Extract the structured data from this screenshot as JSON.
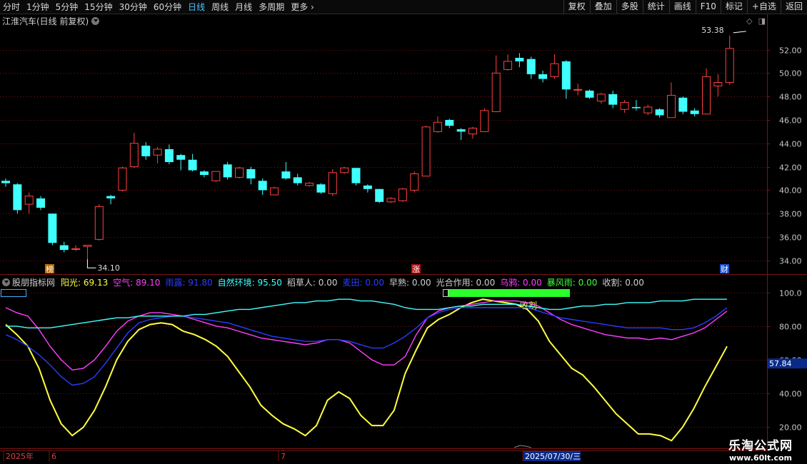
{
  "toolbar": {
    "periods": [
      "分时",
      "1分钟",
      "5分钟",
      "15分钟",
      "30分钟",
      "60分钟",
      "日线",
      "周线",
      "月线",
      "多周期",
      "更多"
    ],
    "active_period": "日线",
    "tools": [
      "复权",
      "叠加",
      "多股",
      "统计",
      "画线",
      "F10",
      "标记",
      "+自选",
      "返回"
    ]
  },
  "stock": {
    "title": "江淮汽车(日线 前复权)"
  },
  "badges": {
    "bang": "榜",
    "zhang": "涨",
    "cai": "财"
  },
  "price_annotations": {
    "high": "53.38",
    "low": "34.10"
  },
  "indicator": {
    "name": "股朋指标网",
    "legend": [
      {
        "label": "阳光: 69.13",
        "color": "#ffff40"
      },
      {
        "label": "空气: 89.10",
        "color": "#ff40ff"
      },
      {
        "label": "雨露: 91.80",
        "color": "#2a3cff"
      },
      {
        "label": "自然环境: 95.50",
        "color": "#40ffff"
      },
      {
        "label": "稻草人: 0.00",
        "color": "#d0d0d0"
      },
      {
        "label": "麦田: 0.00",
        "color": "#2a3cff"
      },
      {
        "label": "早熟: 0.00",
        "color": "#d0d0d0"
      },
      {
        "label": "光合作用: 0.00",
        "color": "#d0d0d0"
      },
      {
        "label": "乌鸦: 0.00",
        "color": "#ff40ff"
      },
      {
        "label": "暴风雨: 0.00",
        "color": "#40ff40"
      },
      {
        "label": "收割: 0.00",
        "color": "#d0d0d0"
      }
    ],
    "harvest_label": "收割",
    "current_value": "57.84"
  },
  "axis": {
    "price_ticks": [
      "52.00",
      "50.00",
      "48.00",
      "46.00",
      "44.00",
      "42.00",
      "40.00",
      "38.00",
      "36.00",
      "34.00"
    ],
    "ind_ticks": [
      "100.0",
      "80.00",
      "60.00",
      "40.00",
      "20.00"
    ],
    "date_labels": [
      "2025年",
      "6",
      "7",
      "2025/07/30/三"
    ]
  },
  "watermark": {
    "line1": "乐淘公式网",
    "line2": "www.60lt.com"
  },
  "colors": {
    "up": "#ff4040",
    "down": "#40ffff",
    "grid": "#7a1414",
    "axis": "#7a1414"
  },
  "chart_data": [
    {
      "type": "candlestick",
      "title": "江淮汽车(日线 前复权)",
      "ylim": [
        33.2,
        53.8
      ],
      "candles": [
        {
          "o": 40.8,
          "c": 40.6,
          "h": 41.0,
          "l": 40.3
        },
        {
          "o": 40.5,
          "c": 38.3,
          "h": 40.6,
          "l": 38.0
        },
        {
          "o": 38.8,
          "c": 39.5,
          "h": 39.8,
          "l": 38.0
        },
        {
          "o": 39.3,
          "c": 38.5,
          "h": 39.5,
          "l": 38.3
        },
        {
          "o": 38.0,
          "c": 35.5,
          "h": 38.0,
          "l": 35.3
        },
        {
          "o": 35.3,
          "c": 34.9,
          "h": 35.6,
          "l": 34.7
        },
        {
          "o": 35.0,
          "c": 35.0,
          "h": 35.3,
          "l": 34.8
        },
        {
          "o": 35.2,
          "c": 35.3,
          "h": 35.3,
          "l": 34.1
        },
        {
          "o": 35.8,
          "c": 38.6,
          "h": 38.8,
          "l": 35.7
        },
        {
          "o": 39.5,
          "c": 39.3,
          "h": 39.6,
          "l": 38.8
        },
        {
          "o": 40.0,
          "c": 41.9,
          "h": 42.0,
          "l": 39.9
        },
        {
          "o": 42.0,
          "c": 44.0,
          "h": 44.9,
          "l": 41.9
        },
        {
          "o": 43.8,
          "c": 42.9,
          "h": 44.1,
          "l": 42.6
        },
        {
          "o": 43.0,
          "c": 43.5,
          "h": 43.7,
          "l": 42.3
        },
        {
          "o": 43.5,
          "c": 42.4,
          "h": 43.9,
          "l": 42.2
        },
        {
          "o": 43.0,
          "c": 42.6,
          "h": 43.1,
          "l": 41.7
        },
        {
          "o": 42.6,
          "c": 41.7,
          "h": 43.1,
          "l": 41.6
        },
        {
          "o": 41.6,
          "c": 41.3,
          "h": 41.7,
          "l": 41.1
        },
        {
          "o": 40.8,
          "c": 41.6,
          "h": 41.6,
          "l": 40.7
        },
        {
          "o": 42.2,
          "c": 41.1,
          "h": 42.4,
          "l": 40.9
        },
        {
          "o": 41.1,
          "c": 41.9,
          "h": 42.0,
          "l": 41.0
        },
        {
          "o": 41.8,
          "c": 41.0,
          "h": 42.0,
          "l": 40.5
        },
        {
          "o": 40.8,
          "c": 40.0,
          "h": 41.0,
          "l": 39.6
        },
        {
          "o": 39.6,
          "c": 40.2,
          "h": 40.3,
          "l": 39.6
        },
        {
          "o": 41.6,
          "c": 41.0,
          "h": 42.4,
          "l": 40.9
        },
        {
          "o": 41.1,
          "c": 40.6,
          "h": 41.4,
          "l": 40.4
        },
        {
          "o": 40.4,
          "c": 40.6,
          "h": 40.7,
          "l": 40.3
        },
        {
          "o": 40.5,
          "c": 39.8,
          "h": 40.6,
          "l": 39.7
        },
        {
          "o": 39.7,
          "c": 41.5,
          "h": 41.8,
          "l": 39.5
        },
        {
          "o": 41.5,
          "c": 41.9,
          "h": 42.0,
          "l": 41.4
        },
        {
          "o": 41.9,
          "c": 40.6,
          "h": 41.9,
          "l": 40.4
        },
        {
          "o": 40.4,
          "c": 40.1,
          "h": 40.5,
          "l": 39.8
        },
        {
          "o": 40.1,
          "c": 39.0,
          "h": 40.1,
          "l": 38.9
        },
        {
          "o": 39.0,
          "c": 39.3,
          "h": 39.4,
          "l": 38.9
        },
        {
          "o": 39.1,
          "c": 40.1,
          "h": 40.2,
          "l": 39.0
        },
        {
          "o": 40.0,
          "c": 41.4,
          "h": 41.6,
          "l": 39.8
        },
        {
          "o": 41.2,
          "c": 45.4,
          "h": 45.5,
          "l": 41.2
        },
        {
          "o": 45.0,
          "c": 45.8,
          "h": 46.3,
          "l": 44.9
        },
        {
          "o": 46.0,
          "c": 45.5,
          "h": 46.1,
          "l": 45.3
        },
        {
          "o": 45.2,
          "c": 45.0,
          "h": 45.3,
          "l": 44.3
        },
        {
          "o": 44.8,
          "c": 45.3,
          "h": 45.4,
          "l": 44.4
        },
        {
          "o": 45.0,
          "c": 46.8,
          "h": 47.0,
          "l": 45.0
        },
        {
          "o": 46.7,
          "c": 50.0,
          "h": 51.5,
          "l": 46.7
        },
        {
          "o": 50.3,
          "c": 51.0,
          "h": 51.6,
          "l": 50.2
        },
        {
          "o": 51.3,
          "c": 51.0,
          "h": 51.7,
          "l": 50.5
        },
        {
          "o": 51.2,
          "c": 49.9,
          "h": 51.4,
          "l": 49.5
        },
        {
          "o": 49.9,
          "c": 49.5,
          "h": 50.2,
          "l": 49.2
        },
        {
          "o": 49.7,
          "c": 50.8,
          "h": 51.6,
          "l": 49.5
        },
        {
          "o": 51.0,
          "c": 48.6,
          "h": 51.1,
          "l": 47.8
        },
        {
          "o": 48.6,
          "c": 48.6,
          "h": 49.1,
          "l": 48.1
        },
        {
          "o": 48.5,
          "c": 47.9,
          "h": 48.6,
          "l": 47.8
        },
        {
          "o": 47.6,
          "c": 48.2,
          "h": 48.3,
          "l": 47.4
        },
        {
          "o": 48.2,
          "c": 47.3,
          "h": 48.5,
          "l": 47.0
        },
        {
          "o": 46.9,
          "c": 47.5,
          "h": 47.7,
          "l": 46.6
        },
        {
          "o": 47.1,
          "c": 47.0,
          "h": 47.7,
          "l": 46.8
        },
        {
          "o": 46.6,
          "c": 47.1,
          "h": 47.3,
          "l": 46.4
        },
        {
          "o": 46.9,
          "c": 46.4,
          "h": 47.0,
          "l": 46.2
        },
        {
          "o": 46.2,
          "c": 48.1,
          "h": 49.2,
          "l": 46.2
        },
        {
          "o": 47.9,
          "c": 46.7,
          "h": 48.0,
          "l": 46.5
        },
        {
          "o": 46.8,
          "c": 46.5,
          "h": 47.0,
          "l": 46.3
        },
        {
          "o": 46.5,
          "c": 49.7,
          "h": 50.4,
          "l": 46.5
        },
        {
          "o": 48.9,
          "c": 49.2,
          "h": 49.9,
          "l": 48.0
        },
        {
          "o": 49.2,
          "c": 52.1,
          "h": 53.2,
          "l": 49.0
        }
      ]
    },
    {
      "type": "line",
      "title": "股朋指标网",
      "ylim": [
        10,
        105
      ],
      "series": [
        {
          "name": "阳光",
          "color": "#ffff40",
          "values": [
            81,
            75,
            68,
            55,
            36,
            22,
            15,
            20,
            30,
            44,
            60,
            71,
            78,
            81,
            82,
            81,
            77,
            75,
            72,
            68,
            62,
            53,
            44,
            33,
            27,
            22,
            19,
            15,
            21,
            36,
            41,
            37,
            27,
            21,
            21,
            30,
            52,
            66,
            79,
            84,
            87,
            91,
            94,
            96,
            95,
            94,
            93,
            90,
            83,
            71,
            63,
            55,
            51,
            44,
            36,
            28,
            22,
            16,
            16,
            15,
            12,
            20,
            31,
            44,
            56,
            68
          ]
        },
        {
          "name": "空气",
          "color": "#ff40ff",
          "values": [
            91,
            88,
            86,
            78,
            68,
            60,
            54,
            55,
            60,
            68,
            77,
            83,
            86,
            88,
            88,
            87,
            86,
            84,
            82,
            80,
            79,
            77,
            75,
            73,
            72,
            71,
            70,
            69,
            70,
            72,
            72,
            70,
            65,
            60,
            57,
            57,
            62,
            75,
            85,
            89,
            91,
            92,
            93,
            94,
            95,
            95,
            95,
            94,
            92,
            88,
            84,
            81,
            79,
            77,
            75,
            74,
            73,
            73,
            72,
            73,
            72,
            74,
            76,
            79,
            84,
            89
          ]
        },
        {
          "name": "雨露",
          "color": "#2a3cff",
          "values": [
            75,
            72,
            68,
            63,
            57,
            50,
            45,
            46,
            50,
            58,
            67,
            76,
            82,
            84,
            85,
            86,
            86,
            85,
            84,
            83,
            82,
            80,
            78,
            76,
            74,
            73,
            72,
            71,
            71,
            72,
            72,
            71,
            69,
            67,
            67,
            70,
            74,
            79,
            85,
            88,
            90,
            91,
            91,
            91,
            91,
            91,
            91,
            91,
            89,
            87,
            85,
            84,
            83,
            82,
            81,
            80,
            79,
            79,
            79,
            79,
            78,
            78,
            79,
            82,
            86,
            91
          ]
        },
        {
          "name": "自然环境",
          "color": "#40ffff",
          "values": [
            80,
            80,
            79,
            79,
            79,
            80,
            81,
            82,
            83,
            84,
            85,
            85,
            86,
            86,
            86,
            86,
            86,
            87,
            87,
            88,
            89,
            90,
            90,
            91,
            92,
            93,
            94,
            94,
            95,
            95,
            96,
            96,
            95,
            95,
            94,
            93,
            91,
            90,
            90,
            90,
            91,
            92,
            92,
            93,
            93,
            93,
            93,
            92,
            91,
            90,
            90,
            91,
            92,
            92,
            93,
            93,
            94,
            94,
            94,
            95,
            95,
            95,
            96,
            96,
            96,
            96
          ]
        }
      ]
    }
  ]
}
